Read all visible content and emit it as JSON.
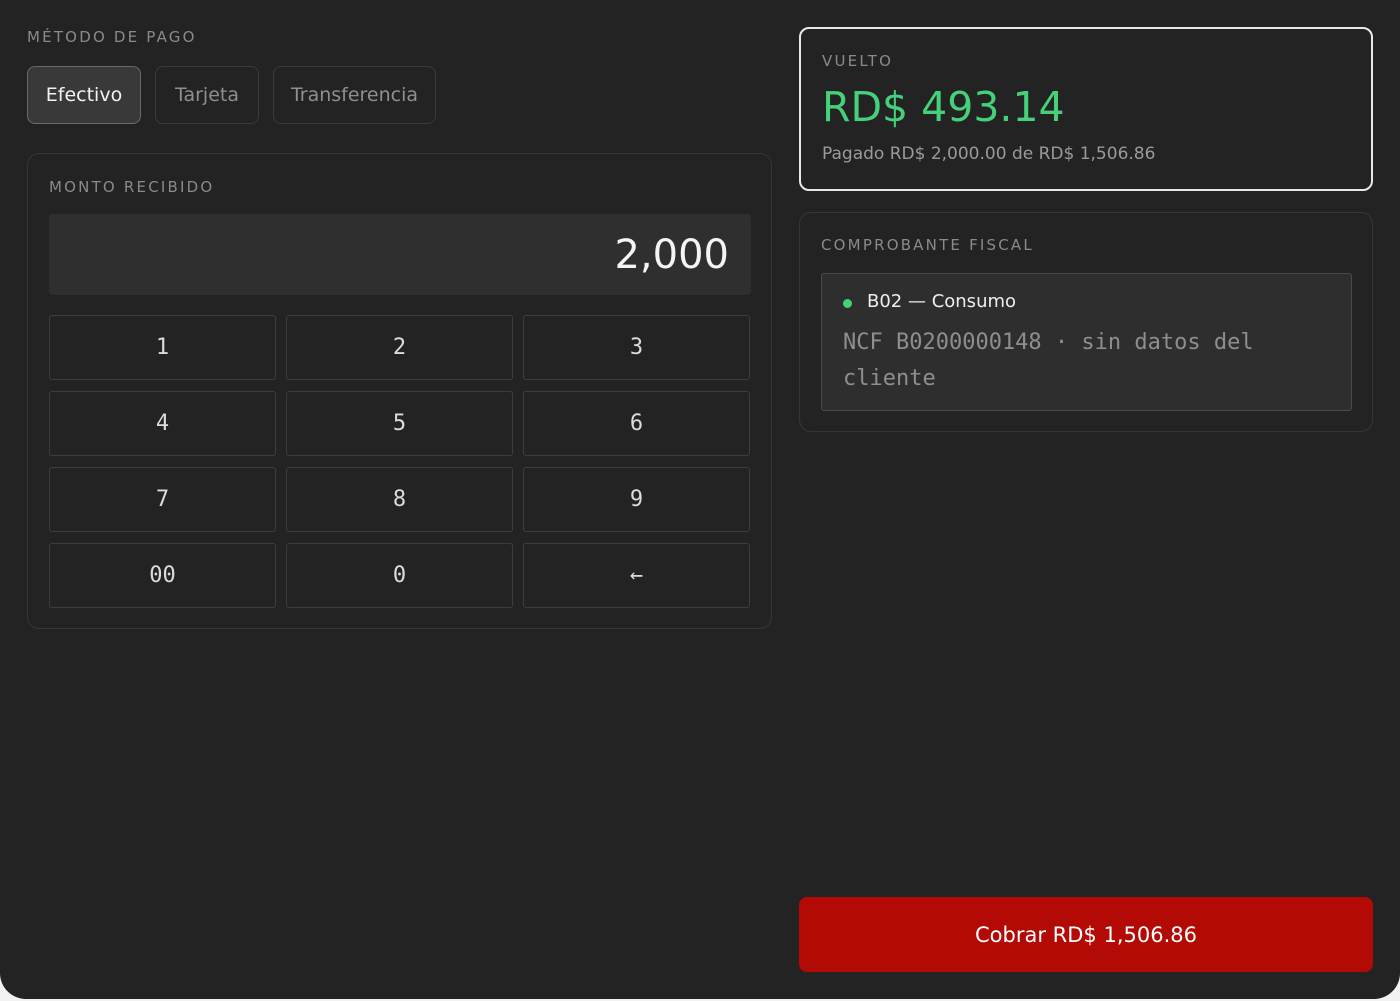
{
  "payment_method": {
    "label": "MÉTODO DE PAGO",
    "tabs": [
      {
        "label": "Efectivo",
        "active": true
      },
      {
        "label": "Tarjeta",
        "active": false
      },
      {
        "label": "Transferencia",
        "active": false
      }
    ]
  },
  "amount": {
    "label": "MONTO RECIBIDO",
    "value": "2,000",
    "keys": [
      "1",
      "2",
      "3",
      "4",
      "5",
      "6",
      "7",
      "8",
      "9",
      "00",
      "0",
      "←"
    ]
  },
  "change": {
    "label": "VUELTO",
    "amount": "RD$ 493.14",
    "detail": "Pagado RD$ 2,000.00 de RD$ 1,506.86"
  },
  "fiscal": {
    "label": "COMPROBANTE FISCAL",
    "type": "B02 — Consumo",
    "ncf": "NCF B0200000148 · sin datos del cliente",
    "status_color": "#44d17a"
  },
  "charge_button": {
    "label": "Cobrar RD$ 1,506.86",
    "color": "#b30a06"
  },
  "colors": {
    "background": "#232323",
    "accent_green": "#44d17a"
  }
}
